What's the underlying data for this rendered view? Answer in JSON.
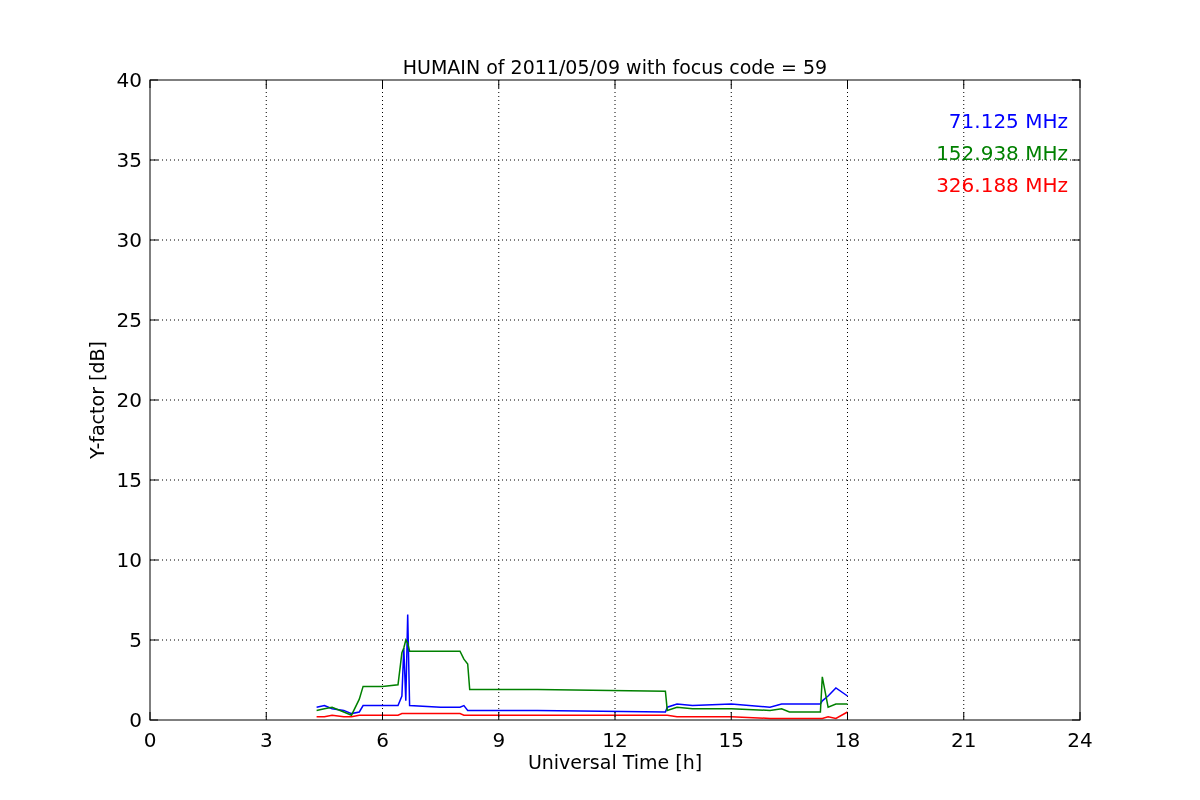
{
  "figure": {
    "chart_data": {
      "type": "line",
      "title": "HUMAIN of 2011/05/09 with focus code = 59",
      "xlabel": "Universal Time [h]",
      "ylabel": "Y-factor [dB]",
      "grid": true,
      "xlim": [
        0,
        24
      ],
      "ylim": [
        0,
        40
      ],
      "xticks": [
        0,
        3,
        6,
        9,
        12,
        15,
        18,
        21,
        24
      ],
      "yticks": [
        0,
        5,
        10,
        15,
        20,
        25,
        30,
        35,
        40
      ],
      "x": [
        4.3,
        4.5,
        4.7,
        5.0,
        5.2,
        5.4,
        5.5,
        6.0,
        6.4,
        6.5,
        6.55,
        6.6,
        6.65,
        6.7,
        7.5,
        8.0,
        8.1,
        8.2,
        8.25,
        10,
        13.3,
        13.35,
        13.6,
        14.0,
        15,
        16.0,
        16.3,
        16.5,
        17.3,
        17.35,
        17.5,
        17.7,
        18.0
      ],
      "series": [
        {
          "name": "71.125 MHz",
          "color": "#0000ff",
          "values": [
            0.8,
            0.9,
            0.7,
            0.6,
            0.4,
            0.5,
            0.9,
            0.9,
            0.9,
            1.5,
            4.5,
            1.2,
            6.6,
            0.9,
            0.8,
            0.8,
            0.9,
            0.6,
            0.6,
            0.6,
            0.5,
            0.8,
            1.0,
            0.9,
            1.0,
            0.8,
            1.0,
            1.0,
            1.0,
            1.2,
            1.5,
            2.0,
            1.5
          ]
        },
        {
          "name": "152.938 MHz",
          "color": "#008000",
          "values": [
            0.6,
            0.7,
            0.8,
            0.5,
            0.3,
            1.3,
            2.1,
            2.1,
            2.2,
            4.2,
            4.5,
            5.0,
            4.8,
            4.3,
            4.3,
            4.3,
            3.8,
            3.5,
            1.9,
            1.9,
            1.8,
            0.6,
            0.8,
            0.7,
            0.7,
            0.6,
            0.7,
            0.5,
            0.5,
            2.7,
            0.8,
            1.0,
            1.0
          ]
        },
        {
          "name": "326.188 MHz",
          "color": "#ff0000",
          "values": [
            0.2,
            0.2,
            0.3,
            0.2,
            0.2,
            0.3,
            0.3,
            0.3,
            0.3,
            0.4,
            0.4,
            0.4,
            0.4,
            0.4,
            0.4,
            0.4,
            0.3,
            0.3,
            0.3,
            0.3,
            0.3,
            0.3,
            0.2,
            0.2,
            0.2,
            0.1,
            0.1,
            0.1,
            0.1,
            0.1,
            0.2,
            0.1,
            0.5
          ]
        }
      ]
    }
  }
}
